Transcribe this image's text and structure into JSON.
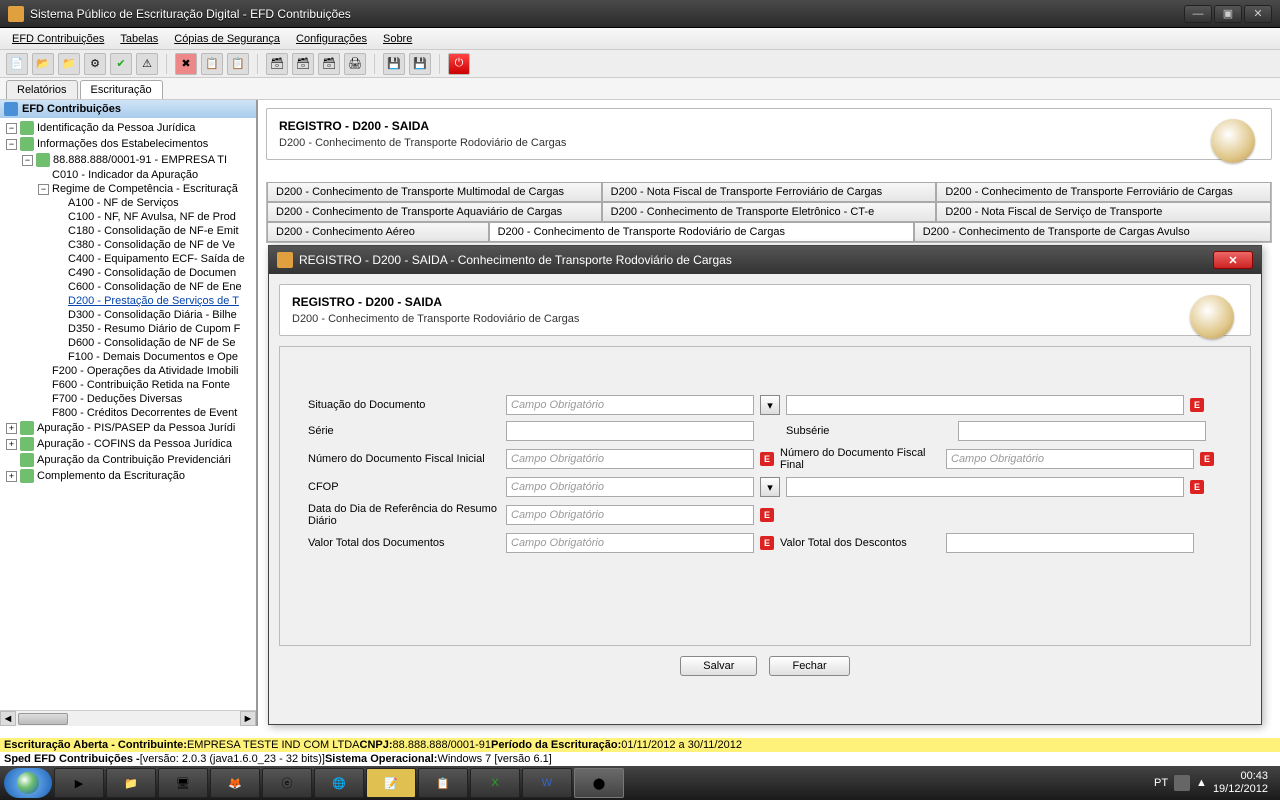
{
  "window": {
    "title": "Sistema Público de Escrituração Digital - EFD Contribuições"
  },
  "menu": [
    "EFD Contribuições",
    "Tabelas",
    "Cópias de Segurança",
    "Configurações",
    "Sobre"
  ],
  "view_tabs": {
    "relatorios": "Relatórios",
    "escrituracao": "Escrituração"
  },
  "tree": {
    "root": "EFD Contribuições",
    "nodes": [
      "Identificação da Pessoa Jurídica",
      "Informações dos Estabelecimentos",
      "88.888.888/0001-91  -  EMPRESA TI",
      "C010 - Indicador da Apuração",
      "Regime de Competência - Escrituraçã",
      "A100 - NF de Serviços",
      "C100 - NF, NF Avulsa, NF de Prod",
      "C180 - Consolidação de NF-e Emit",
      "C380 - Consolidação de NF de Ve",
      "C400 - Equipamento ECF- Saída de",
      "C490 - Consolidação de Documen",
      "C600 - Consolidação de NF de Ene",
      "D200 - Prestação de Serviços de T",
      "D300 - Consolidação Diária - Bilhe",
      "D350 - Resumo Diário de Cupom F",
      "D600 - Consolidação de NF de Se",
      "F100 - Demais Documentos e Ope",
      "F200 - Operações da Atividade Imobili",
      "F600 - Contribuição Retida na Fonte",
      "F700 - Deduções Diversas",
      "F800 - Créditos Decorrentes de Event",
      "Apuração - PIS/PASEP da Pessoa Jurídi",
      "Apuração - COFINS da Pessoa Jurídica",
      "Apuração da Contribuição Previdenciári",
      "Complemento da Escrituração"
    ]
  },
  "register": {
    "title": "REGISTRO - D200 - SAIDA",
    "sub": "D200 - Conhecimento de Transporte Rodoviário de Cargas"
  },
  "doc_tabs": {
    "r1": [
      "D200 - Conhecimento de Transporte Multimodal de Cargas",
      "D200 - Nota Fiscal de Transporte Ferroviário de Cargas",
      "D200 - Conhecimento de Transporte Ferroviário de Cargas"
    ],
    "r2": [
      "D200 - Conhecimento de Transporte Aquaviário de Cargas",
      "D200 - Conhecimento de Transporte Eletrônico - CT-e",
      "D200 - Nota Fiscal de Serviço de Transporte"
    ],
    "r3": [
      "D200 - Conhecimento Aéreo",
      "D200 - Conhecimento de Transporte Rodoviário de Cargas",
      "D200 - Conhecimento de Transporte de Cargas Avulso"
    ]
  },
  "dialog": {
    "title": "REGISTRO - D200 - SAIDA - Conhecimento de Transporte Rodoviário de Cargas",
    "header_title": "REGISTRO - D200 - SAIDA",
    "header_sub": "D200 - Conhecimento de Transporte Rodoviário de Cargas",
    "labels": {
      "sit": "Situação do Documento",
      "serie": "Série",
      "subserie": "Subsérie",
      "num_ini": "Número do Documento Fiscal Inicial",
      "num_fin": "Número do Documento Fiscal Final",
      "cfop": "CFOP",
      "data_ref": "Data do Dia de Referência do Resumo Diário",
      "valor_total": "Valor Total dos Documentos",
      "valor_desc": "Valor Total dos Descontos"
    },
    "placeholder": "Campo Obrigatório",
    "date_mask": "  /  /",
    "buttons": {
      "save": "Salvar",
      "close": "Fechar"
    }
  },
  "status": {
    "line1_pre": "Escrituração Aberta - Contribuinte: ",
    "line1_company": "EMPRESA TESTE IND COM LTDA",
    "line1_cnpj_lbl": " CNPJ: ",
    "line1_cnpj": "88.888.888/0001-91",
    "line1_per_lbl": " Período da Escrituração: ",
    "line1_per": "01/11/2012 a 30/11/2012",
    "line2_pre": "Sped EFD Contribuições - ",
    "line2_ver": "[versão: 2.0.3 (java1.6.0_23 - 32 bits)]",
    "line2_so_lbl": " Sistema Operacional: ",
    "line2_so": "Windows 7 [versão 6.1]"
  },
  "taskbar": {
    "lang": "PT",
    "time": "00:43",
    "date": "19/12/2012"
  }
}
